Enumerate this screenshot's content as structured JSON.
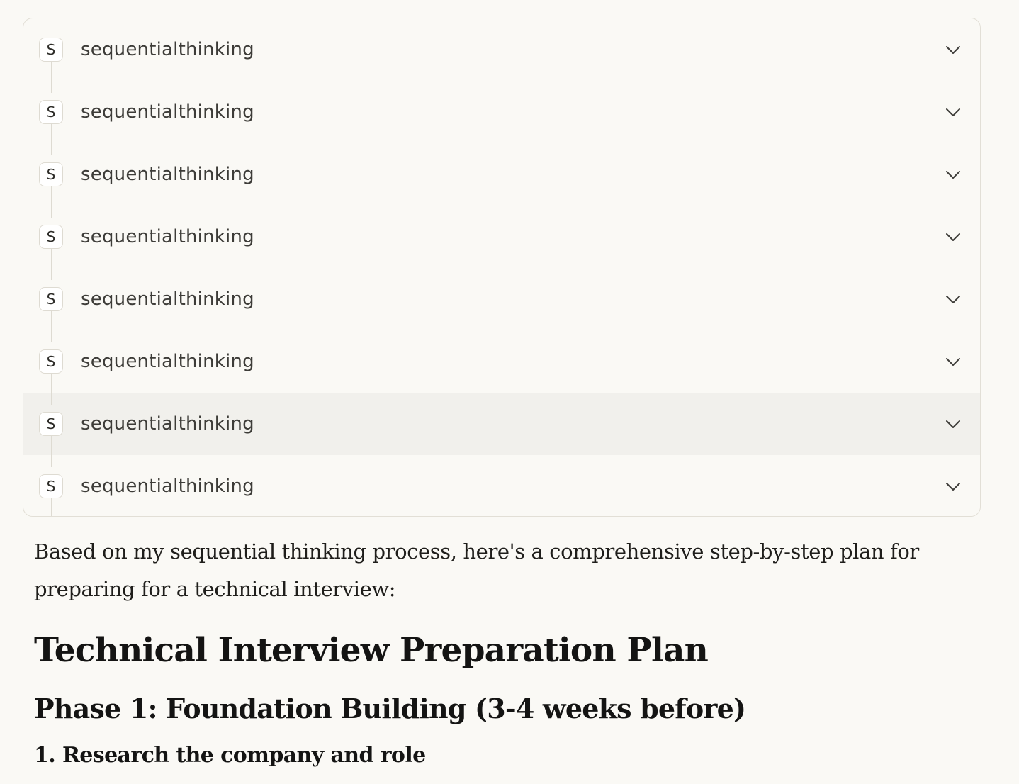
{
  "tool_calls": [
    {
      "badge": "S",
      "label": "sequentialthinking",
      "icon": "chevron-down-icon"
    },
    {
      "badge": "S",
      "label": "sequentialthinking",
      "icon": "chevron-down-icon"
    },
    {
      "badge": "S",
      "label": "sequentialthinking",
      "icon": "chevron-down-icon"
    },
    {
      "badge": "S",
      "label": "sequentialthinking",
      "icon": "chevron-down-icon"
    },
    {
      "badge": "S",
      "label": "sequentialthinking",
      "icon": "chevron-down-icon"
    },
    {
      "badge": "S",
      "label": "sequentialthinking",
      "icon": "chevron-down-icon"
    },
    {
      "badge": "S",
      "label": "sequentialthinking",
      "icon": "chevron-down-icon"
    },
    {
      "badge": "S",
      "label": "sequentialthinking",
      "icon": "chevron-down-icon"
    }
  ],
  "message": {
    "intro": "Based on my sequential thinking process, here's a comprehensive step-by-step plan for preparing for a technical interview:",
    "title": "Technical Interview Preparation Plan",
    "phase_heading": "Phase 1: Foundation Building (3-4 weeks before)",
    "step_heading": "1. Research the company and role"
  },
  "colors": {
    "background": "#faf9f5",
    "panel_border": "#e2dfd6",
    "hover_row": "#f1f0ec",
    "text": "#141413"
  }
}
